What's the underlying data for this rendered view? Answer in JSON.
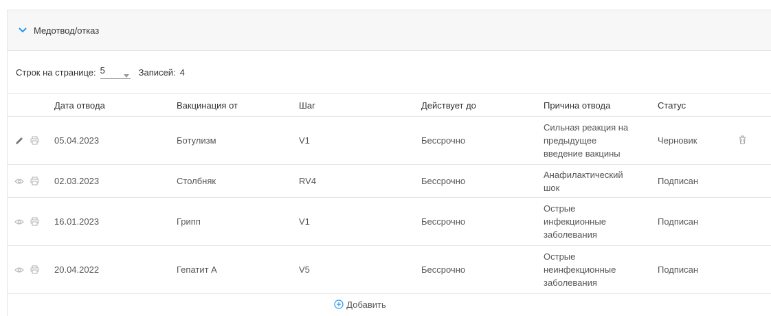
{
  "section": {
    "title": "Медотвод/отказ"
  },
  "pager": {
    "rows_label": "Строк на странице:",
    "rows_value": "5",
    "records_label": "Записей:",
    "records_count": "4"
  },
  "table": {
    "columns": [
      "Дата отвода",
      "Вакцинация от",
      "Шаг",
      "Действует до",
      "Причина отвода",
      "Статус"
    ],
    "rows": [
      {
        "date": "05.04.2023",
        "vaccination": "Ботулизм",
        "step": "V1",
        "valid_until": "Бессрочно",
        "reason_lines": [
          "Сильная реакция на",
          "предыдущее",
          "введение вакцины"
        ],
        "status": "Черновик",
        "view_icon": "pencil-icon",
        "deletable": true
      },
      {
        "date": "02.03.2023",
        "vaccination": "Столбняк",
        "step": "RV4",
        "valid_until": "Бессрочно",
        "reason_lines": [
          "Анафилактический",
          "шок"
        ],
        "status": "Подписан",
        "view_icon": "eye-icon",
        "deletable": false
      },
      {
        "date": "16.01.2023",
        "vaccination": "Грипп",
        "step": "V1",
        "valid_until": "Бессрочно",
        "reason_lines": [
          "Острые",
          "инфекционные",
          "заболевания"
        ],
        "status": "Подписан",
        "view_icon": "eye-icon",
        "deletable": false
      },
      {
        "date": "20.04.2022",
        "vaccination": "Гепатит А",
        "step": "V5",
        "valid_until": "Бессрочно",
        "reason_lines": [
          "Острые",
          "неинфекционные",
          "заболевания"
        ],
        "status": "Подписан",
        "view_icon": "eye-icon",
        "deletable": false
      }
    ]
  },
  "add_label": "Добавить",
  "colors": {
    "accent": "#2196f3",
    "icon_gray": "#9e9e9e",
    "border": "#e6e6e6",
    "header_bg": "#f7f7f7"
  }
}
